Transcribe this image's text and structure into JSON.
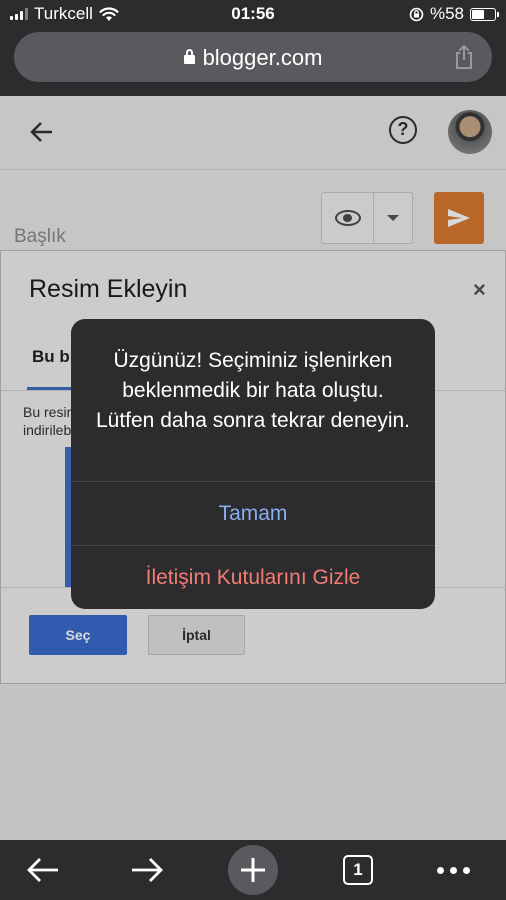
{
  "status_bar": {
    "carrier": "Turkcell",
    "time": "01:56",
    "battery_percent": "%58",
    "battery_level": 0.58
  },
  "browser": {
    "url": "blogger.com",
    "icons": [
      "lock-icon",
      "share-icon"
    ]
  },
  "editor": {
    "title_placeholder": "Başlık",
    "icons": [
      "back-arrow-icon",
      "help-icon",
      "eye-icon",
      "chevron-down-icon",
      "send-icon"
    ]
  },
  "dialog": {
    "title": "Resim Ekleyin",
    "close_label": "×",
    "tab_label": "Bu bl",
    "body_line1": "Bu resim",
    "body_line2": "indirileb",
    "select_label": "Seç",
    "cancel_label": "İptal"
  },
  "alert": {
    "message": "Üzgünüz! Seçiminiz işlenirken beklenmedik bir hata oluştu. Lütfen daha sonra tekrar deneyin.",
    "ok_label": "Tamam",
    "hide_label": "İletişim Kutularını Gizle",
    "ok_color": "#86aef0",
    "hide_color": "#f27c74"
  },
  "toolbar": {
    "tab_count": "1",
    "icons": [
      "back-icon",
      "forward-icon",
      "new-tab-icon",
      "tabs-icon",
      "more-icon"
    ]
  }
}
